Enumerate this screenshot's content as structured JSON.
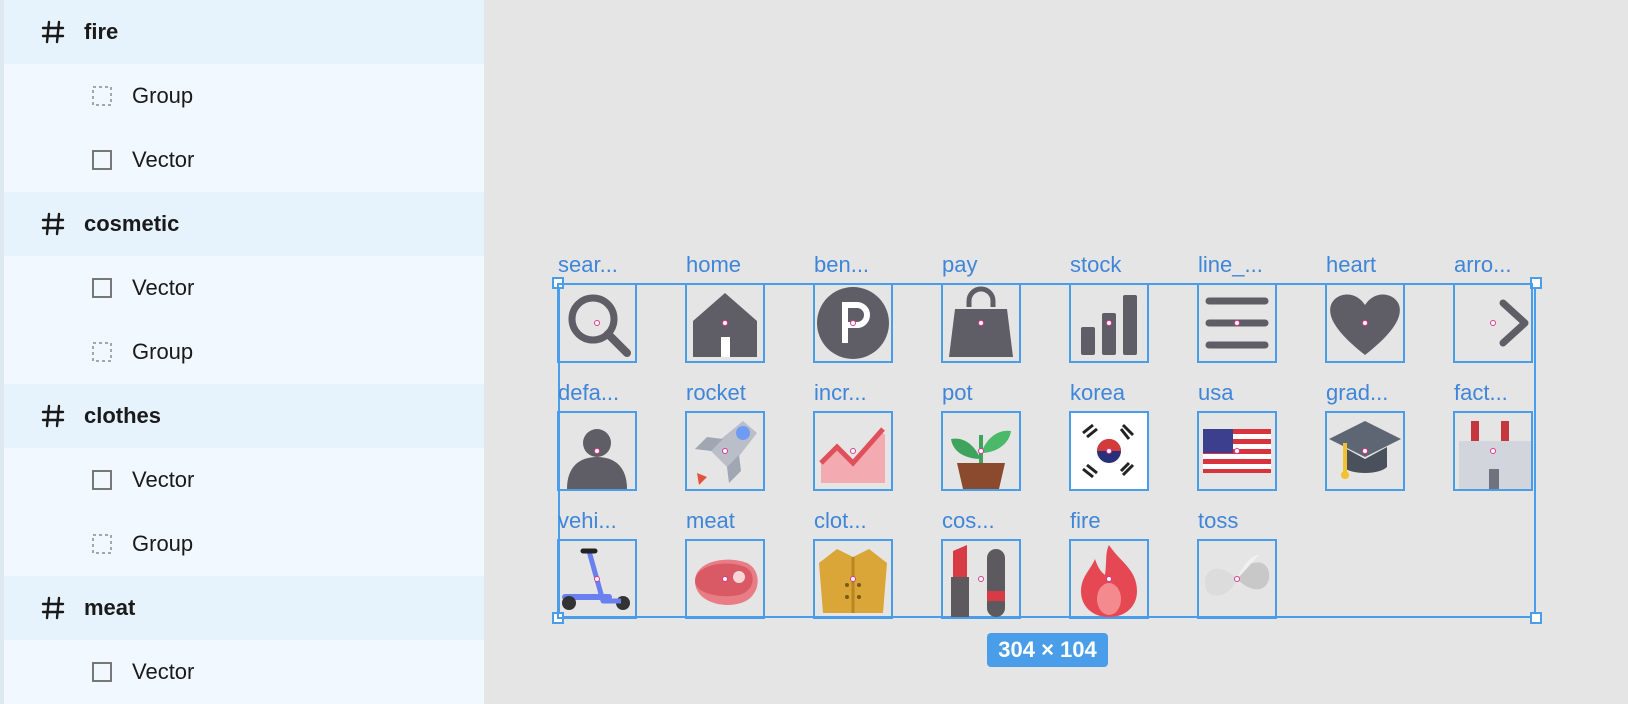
{
  "layers_panel": {
    "rows": [
      {
        "kind": "frame",
        "label": "fire",
        "icon": "hash-icon"
      },
      {
        "kind": "child",
        "label": "Group",
        "icon": "group-dashed-square-icon"
      },
      {
        "kind": "child",
        "label": "Vector",
        "icon": "vector-square-icon"
      },
      {
        "kind": "frame",
        "label": "cosmetic",
        "icon": "hash-icon"
      },
      {
        "kind": "child",
        "label": "Vector",
        "icon": "vector-square-icon"
      },
      {
        "kind": "child",
        "label": "Group",
        "icon": "group-dashed-square-icon"
      },
      {
        "kind": "frame",
        "label": "clothes",
        "icon": "hash-icon"
      },
      {
        "kind": "child",
        "label": "Vector",
        "icon": "vector-square-icon"
      },
      {
        "kind": "child",
        "label": "Group",
        "icon": "group-dashed-square-icon"
      },
      {
        "kind": "frame",
        "label": "meat",
        "icon": "hash-icon"
      },
      {
        "kind": "child",
        "label": "Vector",
        "icon": "vector-square-icon"
      }
    ]
  },
  "canvas": {
    "icons": [
      {
        "label": "sear...",
        "icon": "search-icon"
      },
      {
        "label": "home",
        "icon": "home-icon"
      },
      {
        "label": "ben...",
        "icon": "parking-icon"
      },
      {
        "label": "pay",
        "icon": "shopping-bag-icon"
      },
      {
        "label": "stock",
        "icon": "bar-chart-icon"
      },
      {
        "label": "line_...",
        "icon": "menu-lines-icon"
      },
      {
        "label": "heart",
        "icon": "heart-icon"
      },
      {
        "label": "arro...",
        "icon": "arrow-right-icon"
      },
      {
        "label": "defa...",
        "icon": "default-user-icon"
      },
      {
        "label": "rocket",
        "icon": "rocket-icon"
      },
      {
        "label": "incr...",
        "icon": "increase-chart-icon"
      },
      {
        "label": "pot",
        "icon": "plant-pot-icon"
      },
      {
        "label": "korea",
        "icon": "korea-flag-icon"
      },
      {
        "label": "usa",
        "icon": "usa-flag-icon"
      },
      {
        "label": "grad...",
        "icon": "graduation-cap-icon"
      },
      {
        "label": "fact...",
        "icon": "factory-icon"
      },
      {
        "label": "vehi...",
        "icon": "scooter-icon"
      },
      {
        "label": "meat",
        "icon": "meat-icon"
      },
      {
        "label": "clot...",
        "icon": "coat-icon"
      },
      {
        "label": "cos...",
        "icon": "lipstick-icon"
      },
      {
        "label": "fire",
        "icon": "fire-icon"
      },
      {
        "label": "toss",
        "icon": "toss-logo-icon"
      }
    ],
    "selection_size": "304 × 104"
  },
  "colors": {
    "selection": "#4a9de8",
    "label": "#3f86d8",
    "panel_bg": "#f1f8ff",
    "frame_row_bg": "#e6f3fd",
    "canvas_bg": "#e5e5e5",
    "icon_gray": "#5f5d66"
  }
}
